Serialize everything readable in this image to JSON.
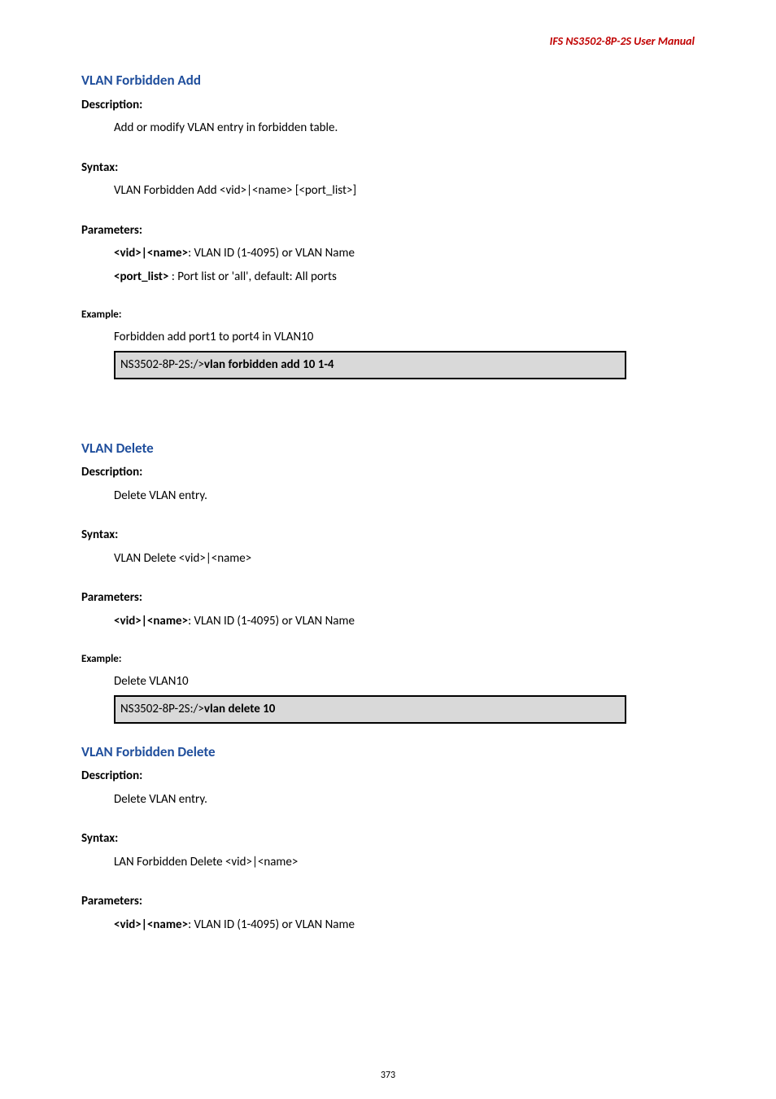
{
  "header": {
    "title": "IFS  NS3502-8P-2S  User  Manual"
  },
  "sections": [
    {
      "heading": "VLAN Forbidden Add",
      "description_label": "Description:",
      "description_text": "Add or modify VLAN entry in forbidden table.",
      "syntax_label": "Syntax:",
      "syntax_text": "VLAN Forbidden Add <vid>|<name> [<port_list>]",
      "parameters_label": "Parameters:",
      "parameters": [
        {
          "key": "<vid>|<name>",
          "desc": ": VLAN ID (1-4095) or VLAN Name"
        },
        {
          "key": "<port_list>",
          "desc": " : Port list or 'all', default: All ports"
        }
      ],
      "example_label": "Example:",
      "example_text": "Forbidden add port1 to port4 in VLAN10",
      "code_prompt": "NS3502-8P-2S:/>",
      "code_cmd": "vlan forbidden add 10 1-4"
    },
    {
      "heading": "VLAN Delete",
      "description_label": "Description:",
      "description_text": "Delete VLAN entry.",
      "syntax_label": "Syntax:",
      "syntax_text": "VLAN Delete <vid>|<name>",
      "parameters_label": "Parameters:",
      "parameters": [
        {
          "key": "<vid>|<name>",
          "desc": ": VLAN ID (1-4095) or VLAN Name"
        }
      ],
      "example_label": "Example:",
      "example_text": "Delete VLAN10",
      "code_prompt": "NS3502-8P-2S:/>",
      "code_cmd": "vlan delete 10"
    },
    {
      "heading": "VLAN Forbidden Delete",
      "description_label": "Description:",
      "description_text": "Delete VLAN entry.",
      "syntax_label": "Syntax:",
      "syntax_text": "LAN Forbidden Delete <vid>|<name>",
      "parameters_label": "Parameters:",
      "parameters": [
        {
          "key": "<vid>|<name>",
          "desc": ": VLAN ID (1-4095) or VLAN Name"
        }
      ]
    }
  ],
  "page_number": "373"
}
